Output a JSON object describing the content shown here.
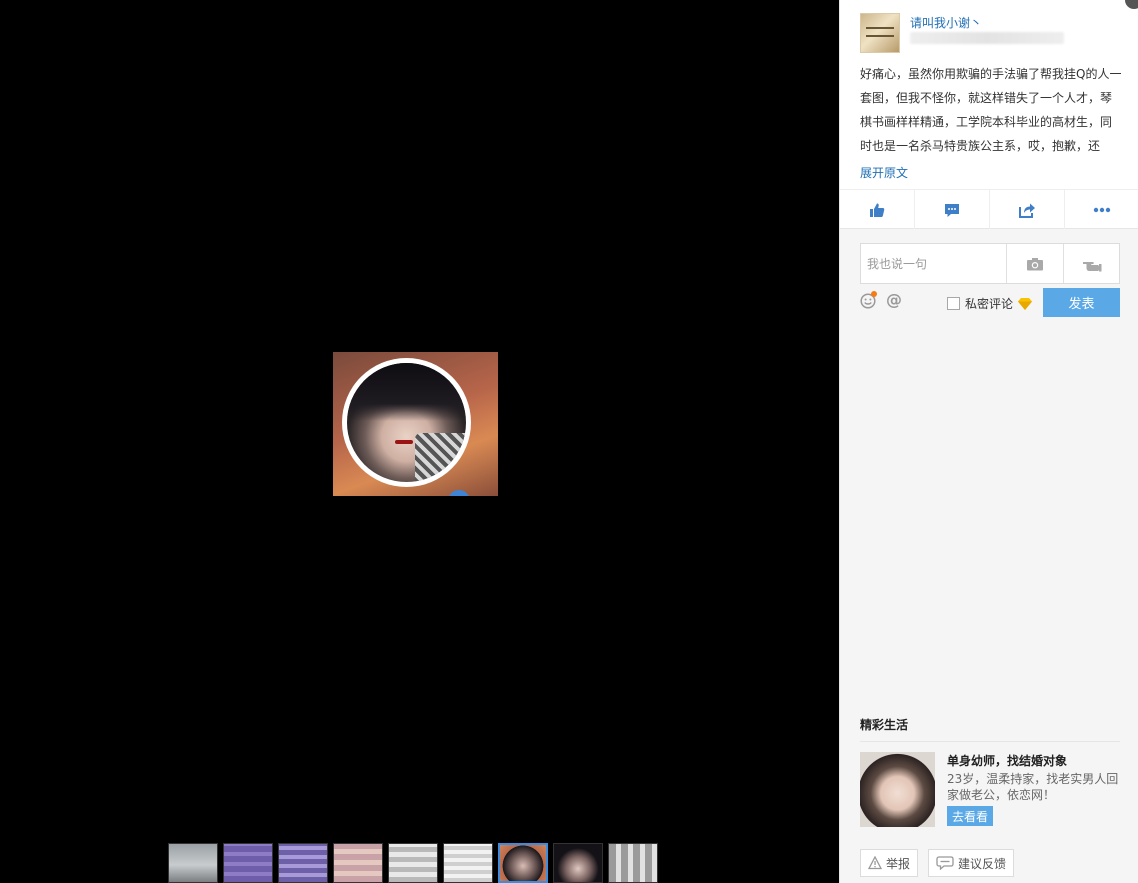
{
  "post": {
    "username": "请叫我小谢丶",
    "text": "好痛心，虽然你用欺骗的手法骗了帮我挂Q的人一套图，但我不怪你，就这样错失了一个人才，琴棋书画样样精通，工学院本科毕业的高材生，同时也是一名杀马特贵族公主系，哎，抱歉，还",
    "expand_label": "展开原文"
  },
  "actions": {
    "like_icon": "thumbs-up-icon",
    "comment_icon": "comment-icon",
    "share_icon": "share-icon",
    "more_icon": "more-dots-icon"
  },
  "comment": {
    "placeholder": "我也说一句",
    "private_label": "私密评论",
    "post_label": "发表"
  },
  "recommend": {
    "section_title": "精彩生活",
    "ad_title": "单身幼师，找结婚对象",
    "ad_desc": "23岁，温柔持家，找老实男人回家做老公，依恋网！",
    "ad_button": "去看看"
  },
  "footer": {
    "report_label": "举报",
    "feedback_label": "建议反馈"
  },
  "thumbnails": {
    "count": 9,
    "active_index": 6
  },
  "colors": {
    "accent": "#5aa9e6",
    "link": "#1f6fb5",
    "viewer_bg": "#000000",
    "panel_bg": "#f5f5f5"
  }
}
